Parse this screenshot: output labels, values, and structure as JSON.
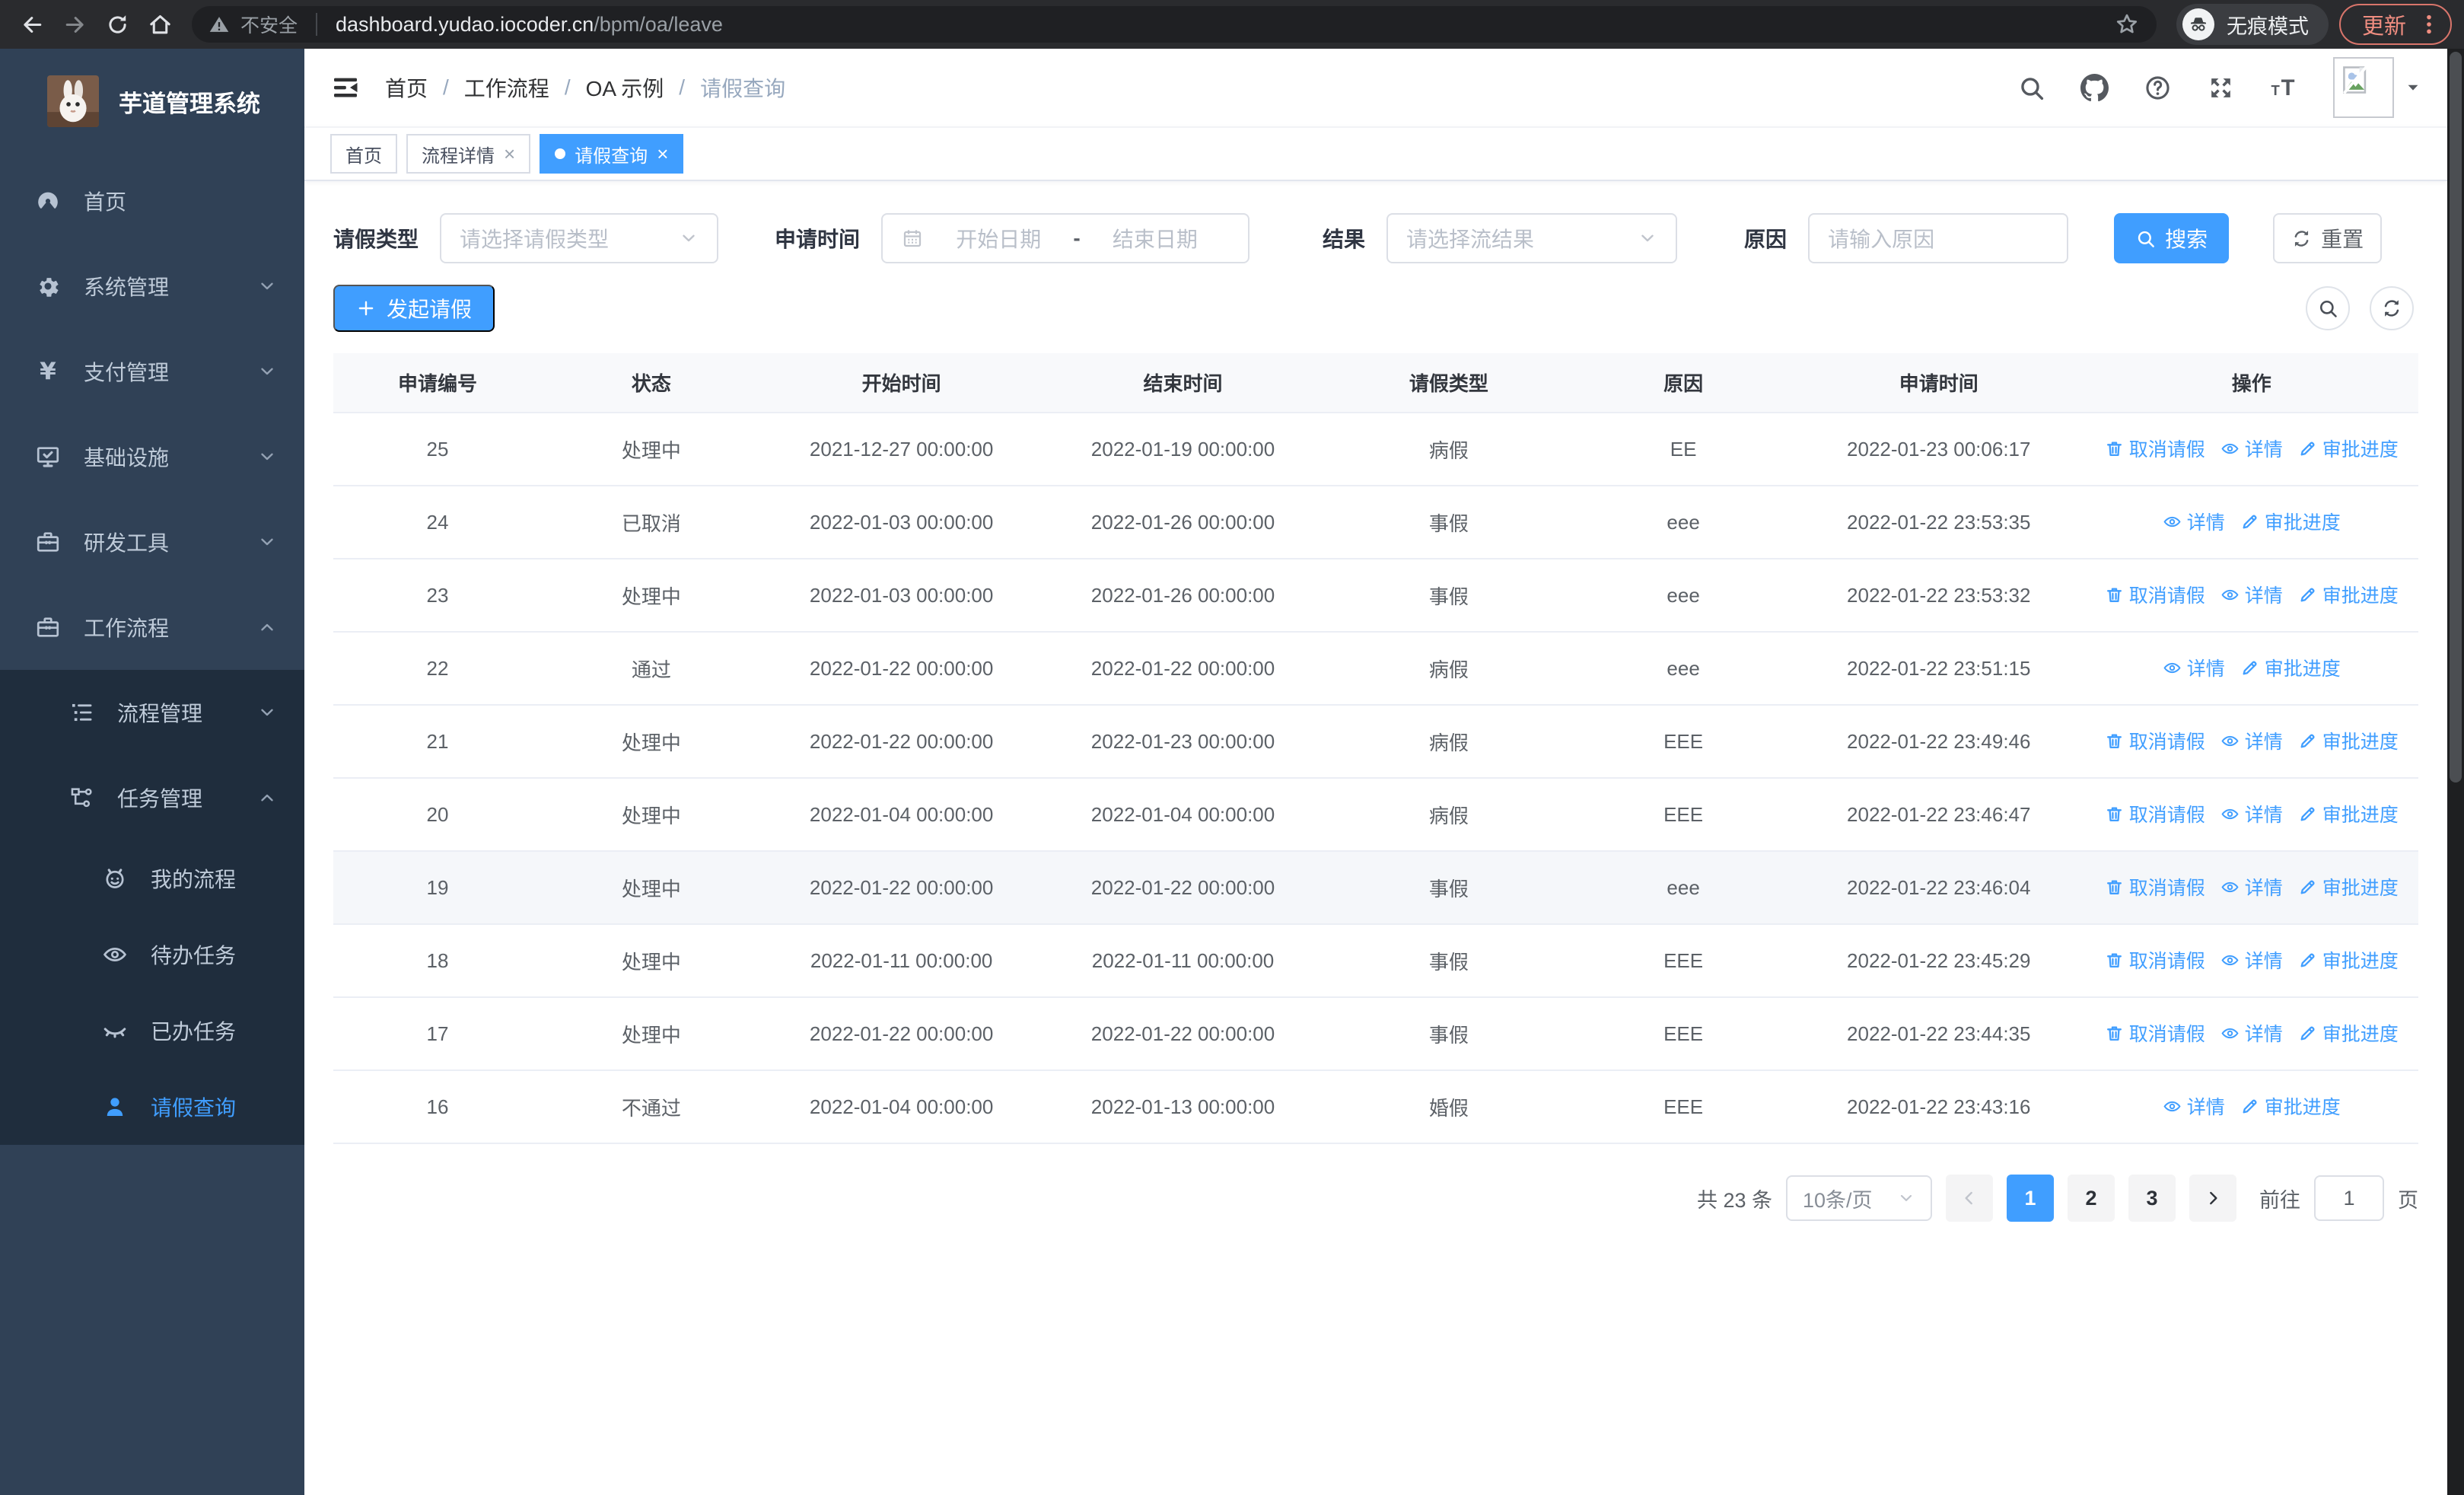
{
  "browser": {
    "security_label": "不安全",
    "url_host": "dashboard.yudao.iocoder.cn",
    "url_path": "/bpm/oa/leave",
    "incognito_label": "无痕模式",
    "update_label": "更新"
  },
  "sidebar": {
    "title": "芋道管理系统",
    "menu": [
      {
        "label": "首页",
        "icon": "dashboard-icon",
        "level": 1
      },
      {
        "label": "系统管理",
        "icon": "gear-icon",
        "level": 1,
        "chevron": "down"
      },
      {
        "label": "支付管理",
        "icon": "yen-icon",
        "level": 1,
        "chevron": "down"
      },
      {
        "label": "基础设施",
        "icon": "monitor-icon",
        "level": 1,
        "chevron": "down"
      },
      {
        "label": "研发工具",
        "icon": "toolbox-icon",
        "level": 1,
        "chevron": "down"
      },
      {
        "label": "工作流程",
        "icon": "toolbox-icon",
        "level": 1,
        "chevron": "up"
      },
      {
        "label": "流程管理",
        "icon": "list-icon",
        "level": 2,
        "chevron": "down"
      },
      {
        "label": "任务管理",
        "icon": "tree-icon",
        "level": 2,
        "chevron": "up"
      },
      {
        "label": "我的流程",
        "icon": "face-icon",
        "level": 3
      },
      {
        "label": "待办任务",
        "icon": "eye-icon",
        "level": 3
      },
      {
        "label": "已办任务",
        "icon": "eye-closed-icon",
        "level": 3
      },
      {
        "label": "请假查询",
        "icon": "user-icon",
        "level": 3,
        "active": true
      }
    ]
  },
  "navbar": {
    "breadcrumb": [
      "首页",
      "工作流程",
      "OA 示例",
      "请假查询"
    ]
  },
  "tabs": [
    {
      "label": "首页",
      "closable": false,
      "active": false
    },
    {
      "label": "流程详情",
      "closable": true,
      "active": false
    },
    {
      "label": "请假查询",
      "closable": true,
      "active": true
    }
  ],
  "filters": {
    "type_label": "请假类型",
    "type_placeholder": "请选择请假类型",
    "time_label": "申请时间",
    "start_placeholder": "开始日期",
    "range_separator": "-",
    "end_placeholder": "结束日期",
    "result_label": "结果",
    "result_placeholder": "请选择流结果",
    "reason_label": "原因",
    "reason_placeholder": "请输入原因",
    "search_label": "搜索",
    "reset_label": "重置"
  },
  "toolbar": {
    "create_label": "发起请假"
  },
  "table": {
    "columns": [
      "申请编号",
      "状态",
      "开始时间",
      "结束时间",
      "请假类型",
      "原因",
      "申请时间",
      "操作"
    ],
    "action_labels": {
      "cancel": "取消请假",
      "detail": "详情",
      "progress": "审批进度"
    },
    "rows": [
      {
        "id": "25",
        "status": "处理中",
        "start": "2021-12-27 00:00:00",
        "end": "2022-01-19 00:00:00",
        "type": "病假",
        "reason": "EE",
        "apply": "2022-01-23 00:06:17",
        "cancellable": true
      },
      {
        "id": "24",
        "status": "已取消",
        "start": "2022-01-03 00:00:00",
        "end": "2022-01-26 00:00:00",
        "type": "事假",
        "reason": "eee",
        "apply": "2022-01-22 23:53:35",
        "cancellable": false
      },
      {
        "id": "23",
        "status": "处理中",
        "start": "2022-01-03 00:00:00",
        "end": "2022-01-26 00:00:00",
        "type": "事假",
        "reason": "eee",
        "apply": "2022-01-22 23:53:32",
        "cancellable": true
      },
      {
        "id": "22",
        "status": "通过",
        "start": "2022-01-22 00:00:00",
        "end": "2022-01-22 00:00:00",
        "type": "病假",
        "reason": "eee",
        "apply": "2022-01-22 23:51:15",
        "cancellable": false
      },
      {
        "id": "21",
        "status": "处理中",
        "start": "2022-01-22 00:00:00",
        "end": "2022-01-23 00:00:00",
        "type": "病假",
        "reason": "EEE",
        "apply": "2022-01-22 23:49:46",
        "cancellable": true
      },
      {
        "id": "20",
        "status": "处理中",
        "start": "2022-01-04 00:00:00",
        "end": "2022-01-04 00:00:00",
        "type": "病假",
        "reason": "EEE",
        "apply": "2022-01-22 23:46:47",
        "cancellable": true
      },
      {
        "id": "19",
        "status": "处理中",
        "start": "2022-01-22 00:00:00",
        "end": "2022-01-22 00:00:00",
        "type": "事假",
        "reason": "eee",
        "apply": "2022-01-22 23:46:04",
        "cancellable": true,
        "hover": true
      },
      {
        "id": "18",
        "status": "处理中",
        "start": "2022-01-11 00:00:00",
        "end": "2022-01-11 00:00:00",
        "type": "事假",
        "reason": "EEE",
        "apply": "2022-01-22 23:45:29",
        "cancellable": true
      },
      {
        "id": "17",
        "status": "处理中",
        "start": "2022-01-22 00:00:00",
        "end": "2022-01-22 00:00:00",
        "type": "事假",
        "reason": "EEE",
        "apply": "2022-01-22 23:44:35",
        "cancellable": true
      },
      {
        "id": "16",
        "status": "不通过",
        "start": "2022-01-04 00:00:00",
        "end": "2022-01-13 00:00:00",
        "type": "婚假",
        "reason": "EEE",
        "apply": "2022-01-22 23:43:16",
        "cancellable": false
      }
    ]
  },
  "pagination": {
    "total": "共 23 条",
    "page_size": "10条/页",
    "pages": [
      "1",
      "2",
      "3"
    ],
    "active_page": "1",
    "goto_label": "前往",
    "goto_value": "1",
    "goto_suffix": "页"
  },
  "colors": {
    "primary": "#409eff",
    "sidebar_bg": "#304156",
    "submenu_bg": "#1f2d3d",
    "update_accent": "#ef8d80"
  }
}
